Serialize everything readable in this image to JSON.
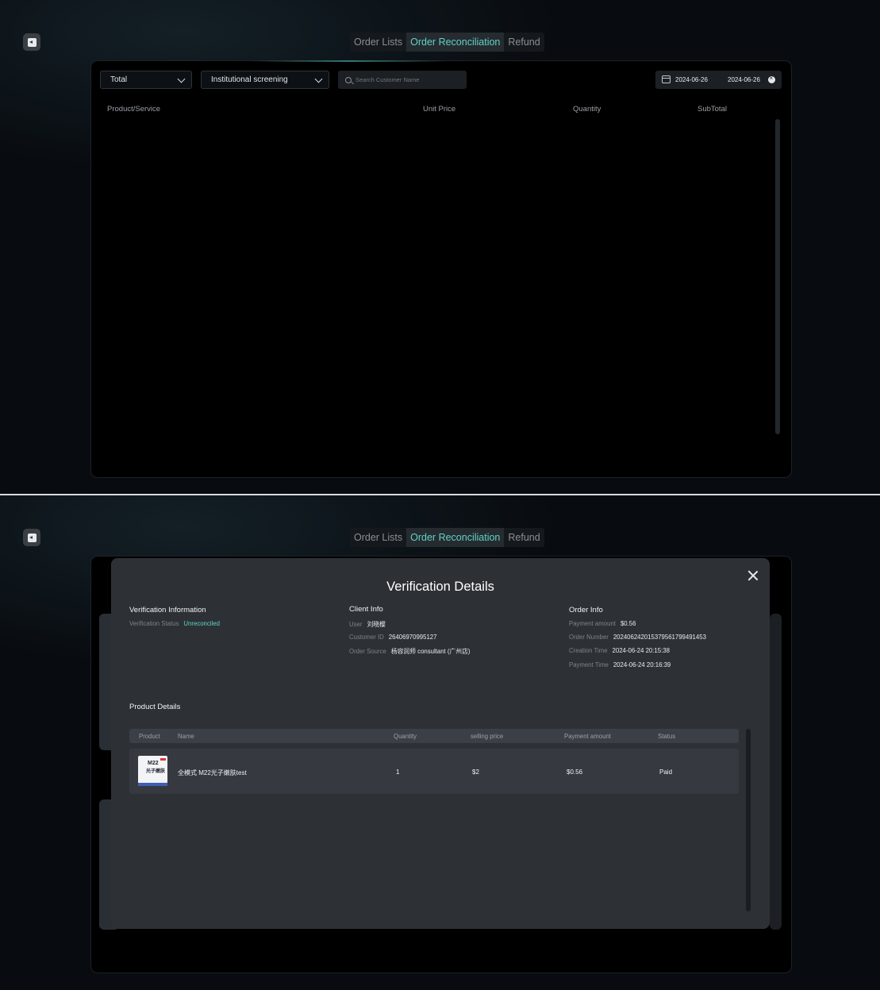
{
  "tabs": [
    {
      "label": "Order Lists",
      "active": false
    },
    {
      "label": "Order Reconciliation",
      "active": true
    },
    {
      "label": "Refund",
      "active": false
    }
  ],
  "colors": {
    "accent": "#5fd3c5",
    "panel": "#000000",
    "modal": "#2d3136"
  },
  "filters": {
    "total_select": "Total",
    "institution_select": "Institutional screening",
    "search_placeholder": "Search Customer Name",
    "date_start": "2024-06-26",
    "date_end": "2024-06-26"
  },
  "table": {
    "columns": [
      "Product/Service",
      "Unit Price",
      "Quantity",
      "SubTotal"
    ],
    "rows": []
  },
  "modal": {
    "title": "Verification Details",
    "verification": {
      "heading": "Verification Information",
      "status_label": "Verification Status",
      "status_value": "Unreconciled"
    },
    "client": {
      "heading": "Client Info",
      "user_label": "User",
      "user_value": "刘晓樱",
      "customer_id_label": "Customer ID",
      "customer_id_value": "26406970995127",
      "source_label": "Order Source",
      "source_value": "杨容润师 consultant (广州店)"
    },
    "order": {
      "heading": "Order Info",
      "amount_label": "Payment amount",
      "amount_value": "$0.56",
      "number_label": "Order Number",
      "number_value": "202406242015379561799491453",
      "creation_label": "Creation Time",
      "creation_value": "2024-06-24 20:15:38",
      "payment_time_label": "Payment Time",
      "payment_time_value": "2024-06-24 20:16:39"
    },
    "product_details": {
      "heading": "Product Details",
      "columns": [
        "Product",
        "Name",
        "Quantity",
        "selling price",
        "Payment amount",
        "Status"
      ],
      "rows": [
        {
          "name": "全模式 M22光子嫩肤test",
          "quantity": "1",
          "selling_price": "$2",
          "payment_amount": "$0.56",
          "status": "Paid"
        }
      ],
      "thumb_brand": "M22",
      "thumb_sub": "光子嫩肤"
    }
  }
}
